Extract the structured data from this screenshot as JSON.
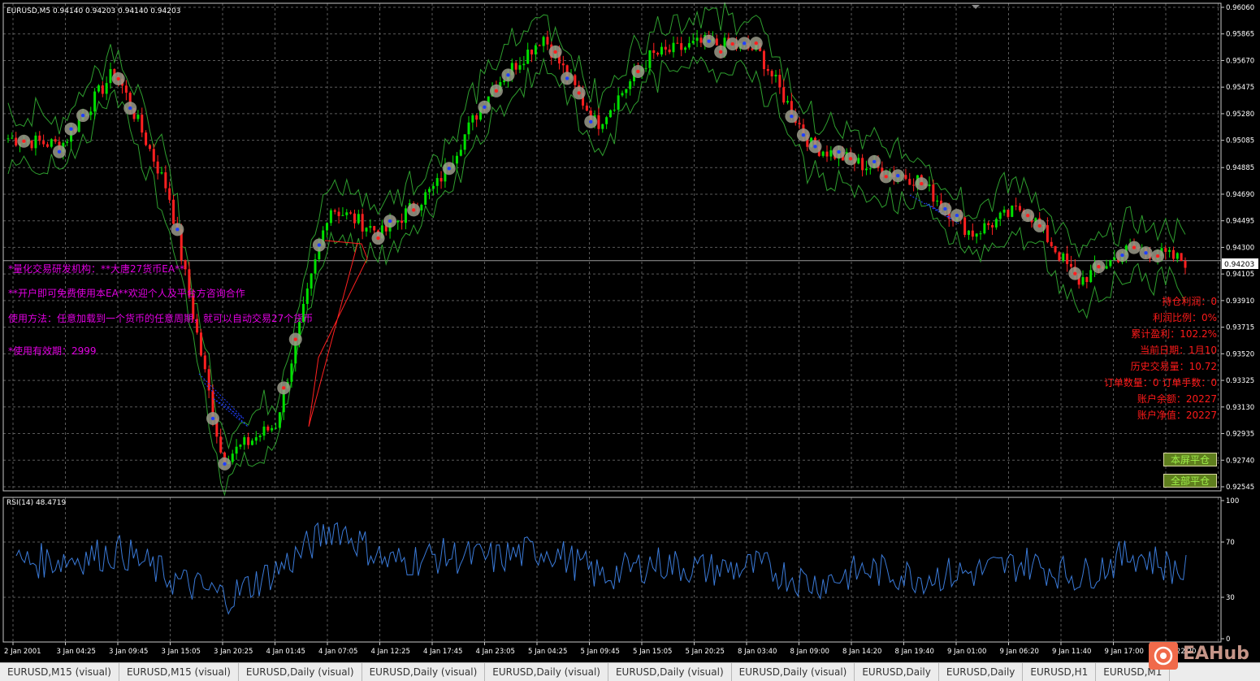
{
  "header": {
    "symbol_info": "EURUSD,M5  0.94140 0.94203 0.94140 0.94203",
    "rsi_info": "RSI(14) 48.4719"
  },
  "price_axis": {
    "labels": [
      "0.96060",
      "0.95865",
      "0.95670",
      "0.95475",
      "0.95280",
      "0.95085",
      "0.94885",
      "0.94690",
      "0.94495",
      "0.94300",
      "0.94105",
      "0.93910",
      "0.93715",
      "0.93520",
      "0.93325",
      "0.93130",
      "0.92935",
      "0.92740",
      "0.92545"
    ],
    "current_price": "0.94203"
  },
  "rsi_axis": {
    "labels": [
      "100",
      "70",
      "30",
      "0"
    ]
  },
  "time_axis": {
    "labels": [
      "2 Jan 2001",
      "3 Jan 04:25",
      "3 Jan 09:45",
      "3 Jan 15:05",
      "3 Jan 20:25",
      "4 Jan 01:45",
      "4 Jan 07:05",
      "4 Jan 12:25",
      "4 Jan 17:45",
      "4 Jan 23:05",
      "5 Jan 04:25",
      "5 Jan 09:45",
      "5 Jan 15:05",
      "5 Jan 20:25",
      "8 Jan 03:40",
      "8 Jan 09:00",
      "8 Jan 14:20",
      "8 Jan 19:40",
      "9 Jan 01:00",
      "9 Jan 06:20",
      "9 Jan 11:40",
      "9 Jan 17:00",
      "9 Jan 22:20"
    ]
  },
  "ea_panel": {
    "line1": "*量化交易研发机构：**大唐27货币EA**",
    "line2": "**开户即可免费使用本EA**欢迎个人及平台方咨询合作",
    "line3": "使用方法：任意加载到一个货币的任意周期，就可以自动交易27个货币",
    "line4": "*使用有效期：2999"
  },
  "stats": {
    "floating_profit": "持仓利润：0",
    "profit_ratio": "利润比例：0%",
    "cumulative_profit": "累计盈利：102.2%",
    "current_date": "当前日期：1月10",
    "history_volume": "历史交易量：10.72",
    "orders": "订单数量：0 订单手数：0",
    "balance": "账户余额：20227",
    "equity": "账户净值：20227"
  },
  "buttons": {
    "close_current": "本屏平仓",
    "close_all": "全部平仓"
  },
  "tabs": [
    {
      "label": "EURUSD,M15 (visual)"
    },
    {
      "label": "EURUSD,M15 (visual)"
    },
    {
      "label": "EURUSD,Daily (visual)"
    },
    {
      "label": "EURUSD,Daily (visual)"
    },
    {
      "label": "EURUSD,Daily (visual)"
    },
    {
      "label": "EURUSD,Daily (visual)"
    },
    {
      "label": "EURUSD,Daily (visual)"
    },
    {
      "label": "EURUSD,Daily"
    },
    {
      "label": "EURUSD,Daily"
    },
    {
      "label": "EURUSD,H1"
    },
    {
      "label": "EURUSD,M1"
    }
  ],
  "watermark": {
    "text": "EAHub",
    "icon": "eahub-logo-icon"
  },
  "colors": {
    "background": "#000000",
    "grid": "#5a5a5a",
    "bull_candle": "#00e000",
    "bear_candle": "#ff2020",
    "envelope": "#2e9e2e",
    "rsi_line": "#3a7ad8",
    "buy_marker": "#2040ff",
    "sell_marker": "#ff2020",
    "marker_halo": "#9a9a8a"
  },
  "chart_data": [
    {
      "type": "line",
      "name": "EURUSD M5 price",
      "ylim": [
        0.92545,
        0.9606
      ],
      "x": [
        "2 Jan 2001",
        "3 Jan 04:25",
        "3 Jan 09:45",
        "3 Jan 15:05",
        "3 Jan 20:25",
        "4 Jan 01:45",
        "4 Jan 07:05",
        "4 Jan 12:25",
        "4 Jan 17:45",
        "4 Jan 23:05",
        "5 Jan 04:25",
        "5 Jan 09:45",
        "5 Jan 15:05",
        "5 Jan 20:25",
        "8 Jan 03:40",
        "8 Jan 09:00",
        "8 Jan 14:20",
        "8 Jan 19:40",
        "9 Jan 01:00",
        "9 Jan 06:20",
        "9 Jan 11:40",
        "9 Jan 17:00",
        "9 Jan 22:20"
      ],
      "series": [
        {
          "values": [
            0.951,
            0.9505,
            0.956,
            0.947,
            0.9275,
            0.93,
            0.946,
            0.944,
            0.9475,
            0.9545,
            0.9585,
            0.952,
            0.957,
            0.958,
            0.9575,
            0.9505,
            0.949,
            0.948,
            0.944,
            0.946,
            0.9405,
            0.943,
            0.942
          ]
        }
      ]
    },
    {
      "type": "line",
      "name": "RSI(14)",
      "ylim": [
        0,
        100
      ],
      "x": [
        "2 Jan 2001",
        "3 Jan 04:25",
        "3 Jan 09:45",
        "3 Jan 15:05",
        "3 Jan 20:25",
        "4 Jan 01:45",
        "4 Jan 07:05",
        "4 Jan 12:25",
        "4 Jan 17:45",
        "4 Jan 23:05",
        "5 Jan 04:25",
        "5 Jan 09:45",
        "5 Jan 15:05",
        "5 Jan 20:25",
        "8 Jan 03:40",
        "8 Jan 09:00",
        "8 Jan 14:20",
        "8 Jan 19:40",
        "9 Jan 01:00",
        "9 Jan 06:20",
        "9 Jan 11:40",
        "9 Jan 17:00",
        "9 Jan 22:20"
      ],
      "series": [
        {
          "values": [
            55,
            58,
            63,
            42,
            30,
            52,
            82,
            55,
            60,
            58,
            65,
            45,
            55,
            50,
            52,
            40,
            50,
            45,
            48,
            55,
            45,
            62,
            48
          ]
        }
      ]
    }
  ]
}
